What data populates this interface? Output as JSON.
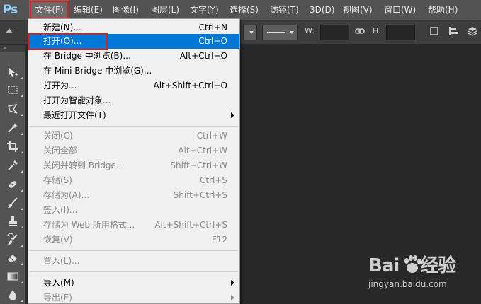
{
  "app": {
    "logo": "Ps"
  },
  "menubar": {
    "items": [
      {
        "label": "文件(F)",
        "active": true
      },
      {
        "label": "编辑(E)"
      },
      {
        "label": "图像(I)"
      },
      {
        "label": "图层(L)"
      },
      {
        "label": "文字(Y)"
      },
      {
        "label": "选择(S)"
      },
      {
        "label": "滤镜(T)"
      },
      {
        "label": "3D(D)"
      },
      {
        "label": "视图(V)"
      },
      {
        "label": "窗口(W)"
      },
      {
        "label": "帮助(H)"
      }
    ]
  },
  "options": {
    "w_label": "W:",
    "h_label": "H:"
  },
  "file_menu": {
    "items": [
      {
        "label": "新建(N)...",
        "shortcut": "Ctrl+N",
        "enabled": true
      },
      {
        "label": "打开(O)...",
        "shortcut": "Ctrl+O",
        "enabled": true,
        "highlighted": true
      },
      {
        "label": "在 Bridge 中浏览(B)...",
        "shortcut": "Alt+Ctrl+O",
        "enabled": true
      },
      {
        "label": "在 Mini Bridge 中浏览(G)...",
        "shortcut": "",
        "enabled": true
      },
      {
        "label": "打开为...",
        "shortcut": "Alt+Shift+Ctrl+O",
        "enabled": true
      },
      {
        "label": "打开为智能对象...",
        "shortcut": "",
        "enabled": true
      },
      {
        "label": "最近打开文件(T)",
        "shortcut": "",
        "enabled": true,
        "submenu": true
      },
      {
        "label": "关闭(C)",
        "shortcut": "Ctrl+W",
        "enabled": false
      },
      {
        "label": "关闭全部",
        "shortcut": "Alt+Ctrl+W",
        "enabled": false
      },
      {
        "label": "关闭并转到 Bridge...",
        "shortcut": "Shift+Ctrl+W",
        "enabled": false
      },
      {
        "label": "存储(S)",
        "shortcut": "Ctrl+S",
        "enabled": false
      },
      {
        "label": "存储为(A)...",
        "shortcut": "Shift+Ctrl+S",
        "enabled": false
      },
      {
        "label": "签入(I)...",
        "shortcut": "",
        "enabled": false
      },
      {
        "label": "存储为 Web 所用格式...",
        "shortcut": "Alt+Shift+Ctrl+S",
        "enabled": false
      },
      {
        "label": "恢复(V)",
        "shortcut": "F12",
        "enabled": false
      },
      {
        "label": "置入(L)...",
        "shortcut": "",
        "enabled": false
      },
      {
        "label": "导入(M)",
        "shortcut": "",
        "enabled": true,
        "submenu": true
      },
      {
        "label": "导出(E)",
        "shortcut": "",
        "enabled": false,
        "submenu": true
      }
    ]
  },
  "watermark": {
    "brand": "Bai",
    "brand_suffix": "经验",
    "url": "jingyan.baidu.com"
  },
  "colors": {
    "highlight": "#0078d7",
    "annotation_red": "#d91f1f",
    "menubar": "#535353",
    "canvas": "#282828"
  }
}
